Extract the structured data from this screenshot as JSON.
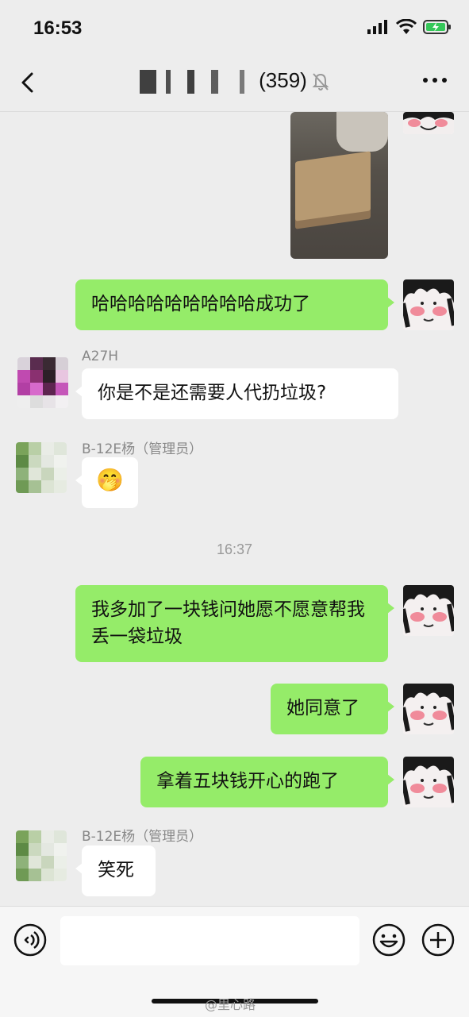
{
  "status": {
    "time": "16:53"
  },
  "header": {
    "title_suffix": "(359)",
    "icons": [
      "back-arrow-icon",
      "mute-bell-icon",
      "more-dots-icon"
    ]
  },
  "messages": [
    {
      "type": "image",
      "side": "right"
    },
    {
      "side": "right",
      "text": "哈哈哈哈哈哈哈哈哈成功了"
    },
    {
      "side": "left",
      "sender": "A27H",
      "text": "你是不是还需要人代扔垃圾?"
    },
    {
      "side": "left",
      "sender": "B-12E杨（管理员）",
      "text": "🤭"
    },
    {
      "type": "timestamp",
      "text": "16:37"
    },
    {
      "side": "right",
      "text": "我多加了一块钱问她愿不愿意帮我丢一袋垃圾"
    },
    {
      "side": "right",
      "text": "她同意了"
    },
    {
      "side": "right",
      "text": "拿着五块钱开心的跑了"
    },
    {
      "side": "left",
      "sender": "B-12E杨（管理员）",
      "text": "笑死"
    }
  ],
  "input": {
    "placeholder": ""
  },
  "watermark": "@里心路",
  "colors": {
    "bubble_self": "#95ec69",
    "bubble_other": "#ffffff",
    "background": "#ededed"
  }
}
